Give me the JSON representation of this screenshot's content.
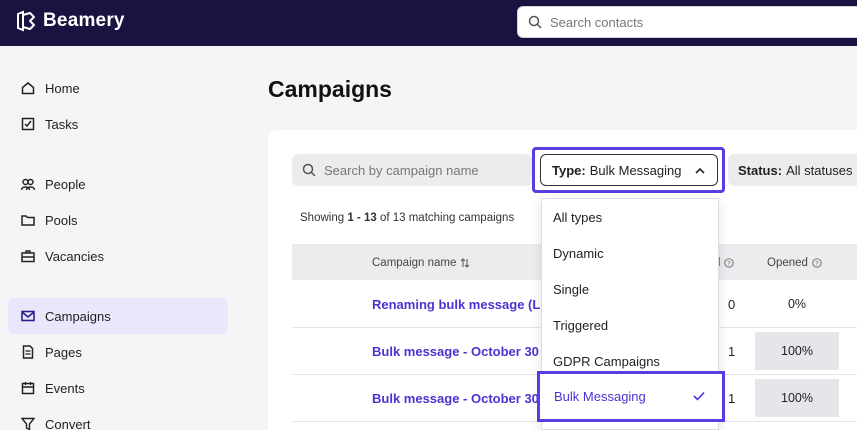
{
  "app": {
    "brand": "Beamery"
  },
  "topbar": {
    "search_placeholder": "Search contacts"
  },
  "sidebar": {
    "items": [
      {
        "label": "Home"
      },
      {
        "label": "Tasks"
      },
      {
        "label": "People"
      },
      {
        "label": "Pools"
      },
      {
        "label": "Vacancies"
      },
      {
        "label": "Campaigns",
        "active": true
      },
      {
        "label": "Pages"
      },
      {
        "label": "Events"
      },
      {
        "label": "Convert"
      }
    ]
  },
  "main": {
    "title": "Campaigns",
    "search_placeholder": "Search by campaign name",
    "type_filter": {
      "label": "Type:",
      "value": "Bulk Messaging"
    },
    "status_filter": {
      "label": "Status:",
      "value": "All statuses"
    },
    "showing": {
      "prefix": "Showing",
      "range": "1 - 13",
      "middle": "of 13 matching campaigns"
    },
    "columns": {
      "name": "Campaign name",
      "sent": "d",
      "opened": "Opened"
    },
    "rows": [
      {
        "name": "Renaming bulk message (L",
        "sent": "0",
        "opened": "0%"
      },
      {
        "name": "Bulk message - October 30",
        "sent": "1",
        "opened": "100%"
      },
      {
        "name": "Bulk message - October 30",
        "sent": "1",
        "opened": "100%"
      }
    ]
  },
  "dropdown": {
    "options": [
      "All types",
      "Dynamic",
      "Single",
      "Triggered",
      "GDPR Campaigns",
      "Bulk Messaging"
    ],
    "selected": "Bulk Messaging"
  },
  "colors": {
    "topbar": "#1a1240",
    "accent": "#5b3be3",
    "link": "#4a34d1"
  }
}
